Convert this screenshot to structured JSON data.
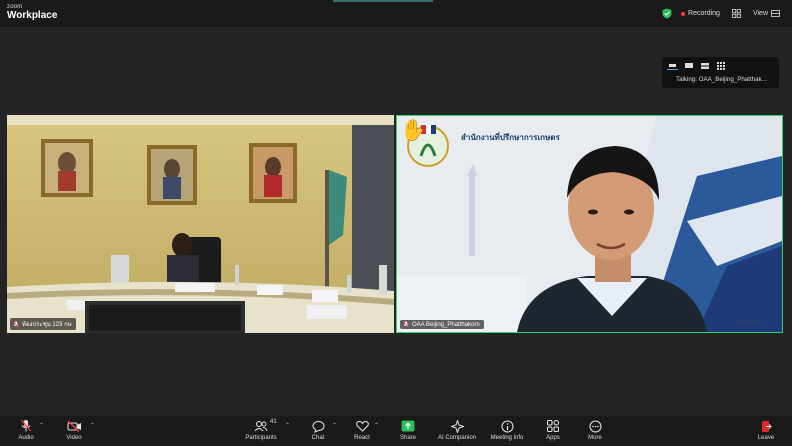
{
  "brand": {
    "line1": "zoom",
    "line2": "Workplace"
  },
  "topbar": {
    "recording_label": "Recording",
    "view_label": "View"
  },
  "talking_panel": {
    "text": "Talking: OAA_Beijing_Phatthak..."
  },
  "tiles": [
    {
      "name": "ห้องประชุม 123 กษ"
    },
    {
      "name": "OAA Beijing_Phatthakorn",
      "banner": "สำนักงานที่ปรึกษาการเกษตร",
      "watermark": "oac.beijing"
    }
  ],
  "toolbar": {
    "audio": "Audio",
    "video": "Video",
    "participants": "Participants",
    "participants_count": "41",
    "chat": "Chat",
    "react": "React",
    "share": "Share",
    "ai_companion": "AI Companion",
    "meeting_info": "Meeting info",
    "apps": "Apps",
    "more": "More",
    "leave": "Leave"
  },
  "colors": {
    "active_speaker_border": "#2fd46a",
    "recording_dot": "#ff3b3b",
    "share_green": "#2bbf5a",
    "leave_red": "#e02828"
  }
}
